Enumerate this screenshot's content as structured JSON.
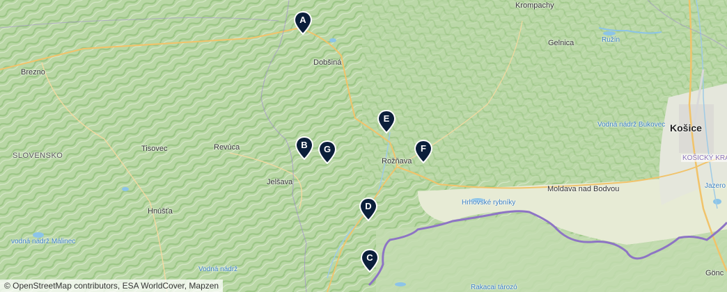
{
  "labels": {
    "krompachy": "Krompachy",
    "gelnica": "Gelnica",
    "ruzin": "Ružín",
    "brezno": "Brezno",
    "dobsina": "Dobšiná",
    "kosice": "Košice",
    "slovensko": "SLOVENSKO",
    "tisovec": "Tisovec",
    "revuca": "Revúca",
    "roznava": "Rožňava",
    "jelsava": "Jelšava",
    "hnusta": "Hnúšťa",
    "bukovec": "Vodná nádrž Bukovec",
    "kosicky_kraj": "KOŠICKÝ KRAJ",
    "moldava": "Moldava nad Bodvou",
    "hrhovske": "Hrhovské rybníky",
    "jazero": "Jazero",
    "malinec": "vodná nádrž Málinec",
    "vodna_nadrz": "Vodná nádrž",
    "gonc": "Gönc",
    "rakaca": "Rakacai tározó"
  },
  "markers": [
    "A",
    "B",
    "C",
    "D",
    "E",
    "F",
    "G"
  ],
  "attribution": "© OpenStreetMap contributors, ESA WorldCover, Mapzen",
  "colors": {
    "terrain": "#c9dfb8",
    "forest": "#a9cf93",
    "lowland": "#e9ecd9",
    "border": "#9178c4",
    "road": "#f1c36a",
    "water": "#8cc4e8",
    "marker": "#0b1f3a"
  }
}
